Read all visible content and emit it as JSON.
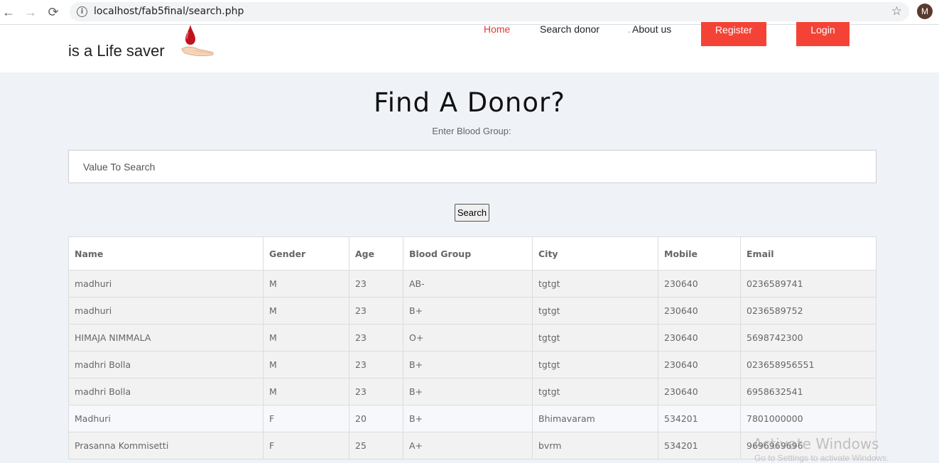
{
  "browser": {
    "back_icon": "←",
    "forward_icon": "→",
    "reload_icon": "⟳",
    "info_icon": "i",
    "url": "localhost/fab5final/search.php",
    "star_icon": "☆",
    "profile_initial": "M"
  },
  "site": {
    "tagline": "is a Life saver",
    "nav": {
      "home": "Home",
      "search_donor": "Search donor",
      "about_dot": ".",
      "about": "About us",
      "register": "Register",
      "login": "Login"
    },
    "accent_color": "#f44336"
  },
  "main": {
    "title": "Find A Donor?",
    "subtitle": "Enter Blood Group:",
    "search_placeholder": "Value To Search",
    "search_button": "Search"
  },
  "table": {
    "headers": [
      "Name",
      "Gender",
      "Age",
      "Blood Group",
      "City",
      "Mobile",
      "Email"
    ],
    "rows": [
      [
        "madhuri",
        "M",
        "23",
        "AB-",
        "tgtgt",
        "230640",
        "0236589741"
      ],
      [
        "madhuri",
        "M",
        "23",
        "B+",
        "tgtgt",
        "230640",
        "0236589752"
      ],
      [
        "HIMAJA NIMMALA",
        "M",
        "23",
        "O+",
        "tgtgt",
        "230640",
        "5698742300"
      ],
      [
        "madhri Bolla",
        "M",
        "23",
        "B+",
        "tgtgt",
        "230640",
        "023658956551"
      ],
      [
        "madhri Bolla",
        "M",
        "23",
        "B+",
        "tgtgt",
        "230640",
        "6958632541"
      ],
      [
        "Madhuri",
        "F",
        "20",
        "B+",
        "Bhimavaram",
        "534201",
        "7801000000"
      ],
      [
        "Prasanna Kommisetti",
        "F",
        "25",
        "A+",
        "bvrm",
        "534201",
        "9696969696"
      ]
    ]
  },
  "os_watermark": {
    "title": "Activate Windows",
    "sub": "Go to Settings to activate Windows."
  }
}
